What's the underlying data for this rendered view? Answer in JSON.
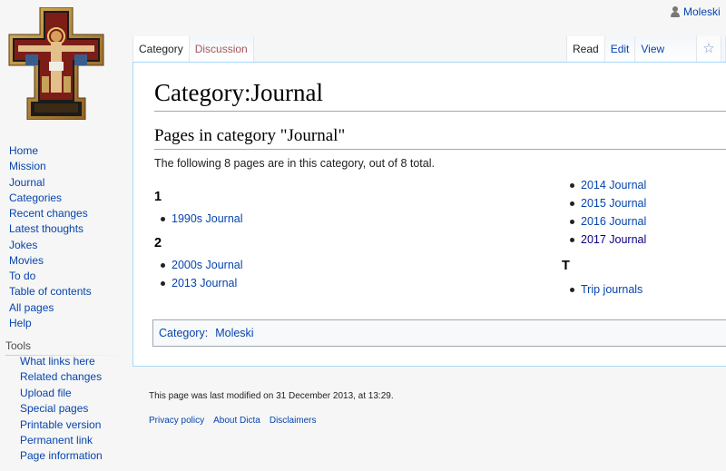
{
  "personal": {
    "username": "Moleski"
  },
  "sidebar": {
    "nav": [
      "Home",
      "Mission",
      "Journal",
      "Categories",
      "Recent changes",
      "Latest thoughts",
      "Jokes",
      "Movies",
      "To do",
      "Table of contents",
      "All pages",
      "Help"
    ],
    "tools_heading": "Tools",
    "tools": [
      "What links here",
      "Related changes",
      "Upload file",
      "Special pages",
      "Printable version",
      "Permanent link",
      "Page information"
    ]
  },
  "tabs": {
    "category": "Category",
    "discussion": "Discussion",
    "read": "Read",
    "edit": "Edit",
    "view_history": "View history",
    "watch_icon": "star-icon"
  },
  "content": {
    "title": "Category:Journal",
    "subheading": "Pages in category \"Journal\"",
    "summary": "The following 8 pages are in this category, out of 8 total.",
    "groups_left": [
      {
        "letter": "1",
        "pages": [
          "1990s Journal"
        ]
      },
      {
        "letter": "2",
        "pages": [
          "2000s Journal",
          "2013 Journal"
        ]
      }
    ],
    "right_pages": [
      "2014 Journal",
      "2015 Journal",
      "2016 Journal",
      "2017 Journal"
    ],
    "group_t": {
      "letter": "T",
      "pages": [
        "Trip journals"
      ]
    },
    "catlinks": {
      "label": "Category:",
      "link": "Moleski"
    }
  },
  "footer": {
    "last_modified": "This page was last modified on 31 December 2013, at 13:29.",
    "links": [
      "Privacy policy",
      "About Dicta",
      "Disclaimers"
    ]
  },
  "colors": {
    "link": "#0645ad",
    "visited": "#0b0080",
    "border": "#a7d7f9",
    "redlink": "#a55858"
  }
}
